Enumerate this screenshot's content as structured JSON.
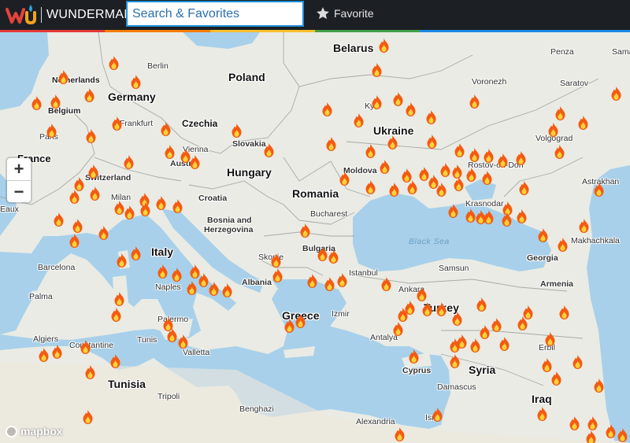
{
  "header": {
    "logo_text": "WUNDERMAP",
    "search_placeholder": "Search & Favorites",
    "favorite_label": "Favorite"
  },
  "zoom": {
    "plus": "+",
    "minus": "−"
  },
  "attribution": "mapbox",
  "icons": {
    "logo": "wu-logo-icon",
    "favorite": "star-icon",
    "fire": "fire-icon"
  },
  "colors": {
    "water": "#a8d0ea",
    "land": "#e9ebe4",
    "fire_outer": "#f35b12",
    "fire_inner": "#ffd23a",
    "search_border": "#1f8fd6"
  },
  "map": {
    "countries": [
      "Belarus",
      "Poland",
      "Germany",
      "Netherlands",
      "Belgium",
      "Czechia",
      "Slovakia",
      "Austria",
      "Hungary",
      "Switzerland",
      "France",
      "Croatia",
      "Bosnia and",
      "Herzegovina",
      "Romania",
      "Moldova",
      "Ukraine",
      "Bulgaria",
      "Italy",
      "Greece",
      "Albania",
      "Turkey",
      "Georgia",
      "Armenia",
      "Syria",
      "Iraq",
      "Tunisia",
      "Cyprus"
    ],
    "cities": [
      "Berlin",
      "Frankfurt",
      "Paris",
      "Vienna",
      "Milan",
      "Bucharest",
      "Skopje",
      "Istanbul",
      "Ankara",
      "Izmir",
      "Antalya",
      "Samsun",
      "Kyiv",
      "Voronezh",
      "Saratov",
      "Penza",
      "Sama",
      "Volgograd",
      "Rostov-on-Don",
      "Krasnodar",
      "Astrakhan",
      "Makhachkala",
      "Barcelona",
      "Palma",
      "Naples",
      "Palermo",
      "Tunis",
      "Algiers",
      "Constantine",
      "Valletta",
      "Tripoli",
      "Benghazi",
      "Alexandria",
      "Damascus",
      "Erbil",
      "Isra",
      "Eaux"
    ],
    "seas": [
      "Black Sea"
    ],
    "fire_count": 150
  }
}
